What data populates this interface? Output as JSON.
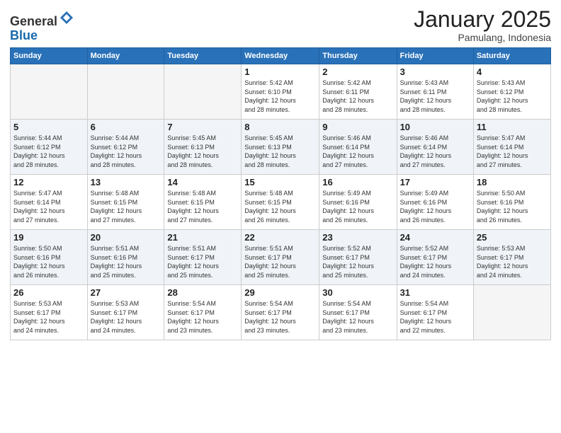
{
  "header": {
    "logo_general": "General",
    "logo_blue": "Blue",
    "month_title": "January 2025",
    "location": "Pamulang, Indonesia"
  },
  "weekdays": [
    "Sunday",
    "Monday",
    "Tuesday",
    "Wednesday",
    "Thursday",
    "Friday",
    "Saturday"
  ],
  "weeks": [
    [
      {
        "day": "",
        "info": ""
      },
      {
        "day": "",
        "info": ""
      },
      {
        "day": "",
        "info": ""
      },
      {
        "day": "1",
        "info": "Sunrise: 5:42 AM\nSunset: 6:10 PM\nDaylight: 12 hours\nand 28 minutes."
      },
      {
        "day": "2",
        "info": "Sunrise: 5:42 AM\nSunset: 6:11 PM\nDaylight: 12 hours\nand 28 minutes."
      },
      {
        "day": "3",
        "info": "Sunrise: 5:43 AM\nSunset: 6:11 PM\nDaylight: 12 hours\nand 28 minutes."
      },
      {
        "day": "4",
        "info": "Sunrise: 5:43 AM\nSunset: 6:12 PM\nDaylight: 12 hours\nand 28 minutes."
      }
    ],
    [
      {
        "day": "5",
        "info": "Sunrise: 5:44 AM\nSunset: 6:12 PM\nDaylight: 12 hours\nand 28 minutes."
      },
      {
        "day": "6",
        "info": "Sunrise: 5:44 AM\nSunset: 6:12 PM\nDaylight: 12 hours\nand 28 minutes."
      },
      {
        "day": "7",
        "info": "Sunrise: 5:45 AM\nSunset: 6:13 PM\nDaylight: 12 hours\nand 28 minutes."
      },
      {
        "day": "8",
        "info": "Sunrise: 5:45 AM\nSunset: 6:13 PM\nDaylight: 12 hours\nand 28 minutes."
      },
      {
        "day": "9",
        "info": "Sunrise: 5:46 AM\nSunset: 6:14 PM\nDaylight: 12 hours\nand 27 minutes."
      },
      {
        "day": "10",
        "info": "Sunrise: 5:46 AM\nSunset: 6:14 PM\nDaylight: 12 hours\nand 27 minutes."
      },
      {
        "day": "11",
        "info": "Sunrise: 5:47 AM\nSunset: 6:14 PM\nDaylight: 12 hours\nand 27 minutes."
      }
    ],
    [
      {
        "day": "12",
        "info": "Sunrise: 5:47 AM\nSunset: 6:14 PM\nDaylight: 12 hours\nand 27 minutes."
      },
      {
        "day": "13",
        "info": "Sunrise: 5:48 AM\nSunset: 6:15 PM\nDaylight: 12 hours\nand 27 minutes."
      },
      {
        "day": "14",
        "info": "Sunrise: 5:48 AM\nSunset: 6:15 PM\nDaylight: 12 hours\nand 27 minutes."
      },
      {
        "day": "15",
        "info": "Sunrise: 5:48 AM\nSunset: 6:15 PM\nDaylight: 12 hours\nand 26 minutes."
      },
      {
        "day": "16",
        "info": "Sunrise: 5:49 AM\nSunset: 6:16 PM\nDaylight: 12 hours\nand 26 minutes."
      },
      {
        "day": "17",
        "info": "Sunrise: 5:49 AM\nSunset: 6:16 PM\nDaylight: 12 hours\nand 26 minutes."
      },
      {
        "day": "18",
        "info": "Sunrise: 5:50 AM\nSunset: 6:16 PM\nDaylight: 12 hours\nand 26 minutes."
      }
    ],
    [
      {
        "day": "19",
        "info": "Sunrise: 5:50 AM\nSunset: 6:16 PM\nDaylight: 12 hours\nand 26 minutes."
      },
      {
        "day": "20",
        "info": "Sunrise: 5:51 AM\nSunset: 6:16 PM\nDaylight: 12 hours\nand 25 minutes."
      },
      {
        "day": "21",
        "info": "Sunrise: 5:51 AM\nSunset: 6:17 PM\nDaylight: 12 hours\nand 25 minutes."
      },
      {
        "day": "22",
        "info": "Sunrise: 5:51 AM\nSunset: 6:17 PM\nDaylight: 12 hours\nand 25 minutes."
      },
      {
        "day": "23",
        "info": "Sunrise: 5:52 AM\nSunset: 6:17 PM\nDaylight: 12 hours\nand 25 minutes."
      },
      {
        "day": "24",
        "info": "Sunrise: 5:52 AM\nSunset: 6:17 PM\nDaylight: 12 hours\nand 24 minutes."
      },
      {
        "day": "25",
        "info": "Sunrise: 5:53 AM\nSunset: 6:17 PM\nDaylight: 12 hours\nand 24 minutes."
      }
    ],
    [
      {
        "day": "26",
        "info": "Sunrise: 5:53 AM\nSunset: 6:17 PM\nDaylight: 12 hours\nand 24 minutes."
      },
      {
        "day": "27",
        "info": "Sunrise: 5:53 AM\nSunset: 6:17 PM\nDaylight: 12 hours\nand 24 minutes."
      },
      {
        "day": "28",
        "info": "Sunrise: 5:54 AM\nSunset: 6:17 PM\nDaylight: 12 hours\nand 23 minutes."
      },
      {
        "day": "29",
        "info": "Sunrise: 5:54 AM\nSunset: 6:17 PM\nDaylight: 12 hours\nand 23 minutes."
      },
      {
        "day": "30",
        "info": "Sunrise: 5:54 AM\nSunset: 6:17 PM\nDaylight: 12 hours\nand 23 minutes."
      },
      {
        "day": "31",
        "info": "Sunrise: 5:54 AM\nSunset: 6:17 PM\nDaylight: 12 hours\nand 22 minutes."
      },
      {
        "day": "",
        "info": ""
      }
    ]
  ]
}
